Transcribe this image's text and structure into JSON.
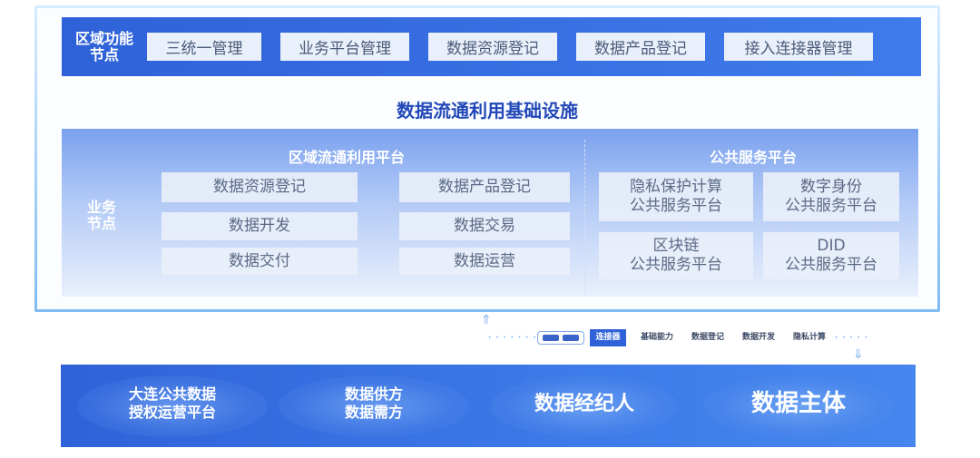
{
  "region": {
    "label": "区域功能\n节点",
    "items": [
      "三统一管理",
      "业务平台管理",
      "数据资源登记",
      "数据产品登记",
      "接入连接器管理"
    ]
  },
  "infra_title": "数据流通利用基础设施",
  "business": {
    "label": "业务\n节点",
    "left_title": "区域流通利用平台",
    "left_items": [
      "数据资源登记",
      "数据产品登记",
      "数据开发",
      "数据交易",
      "数据交付",
      "数据运营"
    ],
    "right_title": "公共服务平台",
    "right_items": [
      "隐私保护计算\n公共服务平台",
      "数字身份\n公共服务平台",
      "区块链\n公共服务平台",
      "DID\n公共服务平台"
    ]
  },
  "connector": {
    "up_arrow": "⇑",
    "down_arrow": "⇓",
    "dots_left": "·········",
    "dots_right": "·····",
    "tags": [
      "连接器",
      "基础能力",
      "数据登记",
      "数据开发",
      "隐私计算"
    ]
  },
  "bottom": {
    "items": [
      "大连公共数据\n授权运营平台",
      "数据供方\n数据需方",
      "数据经纪人",
      "数据主体"
    ]
  },
  "colors": {
    "primary": "#2f62d8",
    "title": "#2348b8",
    "cell_bg": "#eaeff9"
  }
}
